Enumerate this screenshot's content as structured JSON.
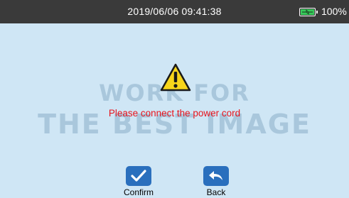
{
  "status_bar": {
    "datetime": "2019/06/06 09:41:38",
    "battery_icon": "battery-charging-icon",
    "battery_percent": "100%",
    "battery_level": 1.0,
    "background_color": "#3a3a3a"
  },
  "dialog": {
    "icon": "warning-triangle-icon",
    "message": "Please connect the power cord",
    "message_color": "#e8141c"
  },
  "watermark": {
    "line1": "WORK FOR",
    "line2": "THE BEST IMAGE"
  },
  "actions": {
    "confirm": {
      "icon": "checkmark-icon",
      "label": "Confirm"
    },
    "back": {
      "icon": "back-arrow-icon",
      "label": "Back"
    }
  },
  "colors": {
    "background": "#cfe6f5",
    "button": "#2a6fbd",
    "warning": "#f7d51b"
  }
}
